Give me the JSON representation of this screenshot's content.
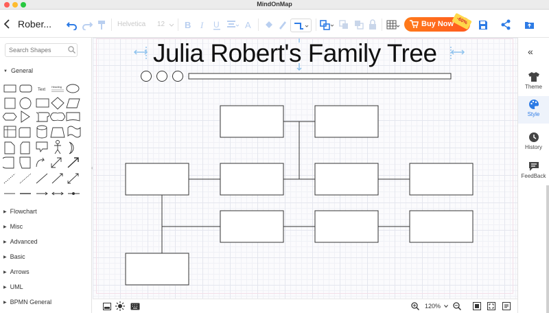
{
  "window": {
    "title": "MindOnMap"
  },
  "toolbar": {
    "doc_name": "Rober...",
    "font_family": "Helvetica",
    "font_size": "12",
    "buy_label": "Buy Now",
    "discount_badge": "-60%"
  },
  "sidebar": {
    "search_placeholder": "Search Shapes",
    "general_label": "General",
    "text_shape_label": "Text",
    "heading_shape_label": "Heading",
    "categories": [
      "Flowchart",
      "Misc",
      "Advanced",
      "Basic",
      "Arrows",
      "UML",
      "BPMN General"
    ]
  },
  "canvas": {
    "title": "Julia Robert's Family Tree"
  },
  "right_panel": {
    "items": [
      {
        "label": "Theme",
        "icon": "shirt-icon"
      },
      {
        "label": "Style",
        "icon": "palette-icon"
      },
      {
        "label": "History",
        "icon": "clock-icon"
      },
      {
        "label": "FeedBack",
        "icon": "feedback-icon"
      }
    ]
  },
  "status": {
    "zoom": "120%"
  },
  "colors": {
    "accent": "#2d7be5",
    "buy_button": "#ff6a1a",
    "badge": "#ffd84a"
  }
}
